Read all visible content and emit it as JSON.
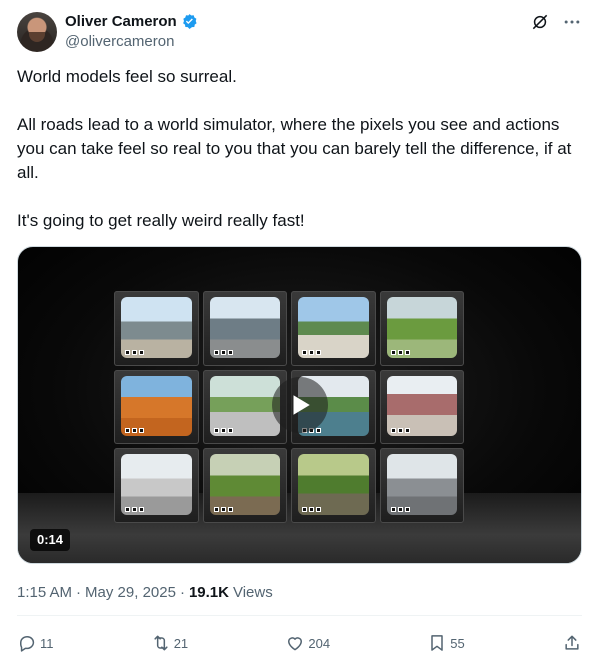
{
  "author": {
    "display_name": "Oliver Cameron",
    "handle": "@olivercameron",
    "verified": true
  },
  "tweet": {
    "paragraphs": [
      "World models feel so surreal.",
      "All roads lead to a world simulator, where the pixels you see and actions you can take feel so real to you that you can barely tell the difference, if at all.",
      "It's going to get really weird really fast!"
    ]
  },
  "media": {
    "duration": "0:14"
  },
  "meta": {
    "time": "1:15 AM",
    "date": "May 29, 2025",
    "views_count": "19.1K",
    "views_label": "Views"
  },
  "actions": {
    "replies": "11",
    "reposts": "21",
    "likes": "204",
    "bookmarks": "55"
  },
  "colors": {
    "verified_blue": "#1d9bf0",
    "secondary_text": "#536471",
    "primary_text": "#0f1419"
  }
}
